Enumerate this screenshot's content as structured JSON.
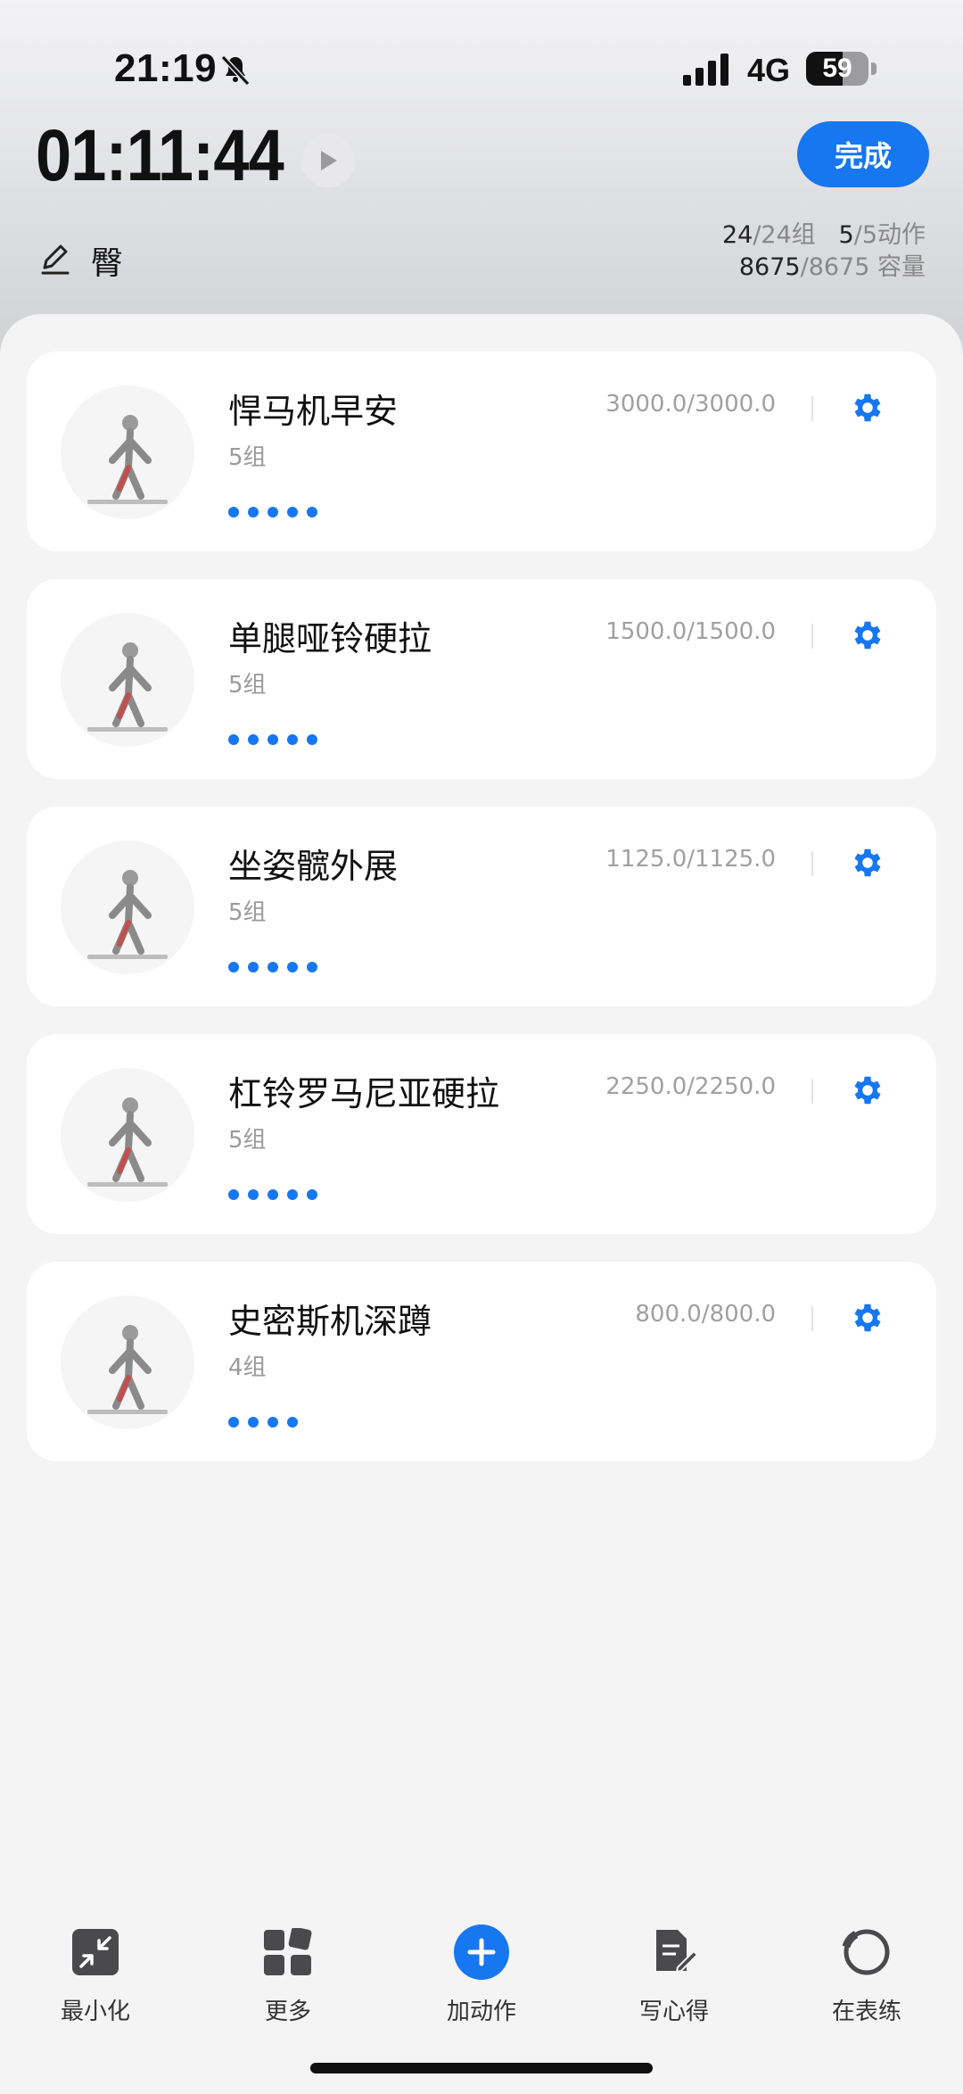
{
  "status_bar": {
    "time": "21:19",
    "network": "4G",
    "battery": "59",
    "battery_level_percent": 59,
    "icons": [
      "bell-muted-icon",
      "signal-icon",
      "battery-icon"
    ]
  },
  "header": {
    "timer": "01:11:44",
    "done_label": "完成",
    "muscle": "臀",
    "sets_done": "24",
    "sets_total": "/24组",
    "actions_done": "5",
    "actions_total": "/5动作",
    "volume_done": "8675",
    "volume_total": "/8675",
    "volume_unit": "容量"
  },
  "exercises": [
    {
      "name": "悍马机早安",
      "sets": "5组",
      "volume": "3000.0/3000.0",
      "dot_count": 5,
      "icon": "machine-good-morning-icon"
    },
    {
      "name": "单腿哑铃硬拉",
      "sets": "5组",
      "volume": "1500.0/1500.0",
      "dot_count": 5,
      "icon": "single-leg-deadlift-icon"
    },
    {
      "name": "坐姿髋外展",
      "sets": "5组",
      "volume": "1125.0/1125.0",
      "dot_count": 5,
      "icon": "seated-hip-abduction-icon"
    },
    {
      "name": "杠铃罗马尼亚硬拉",
      "sets": "5组",
      "volume": "2250.0/2250.0",
      "dot_count": 5,
      "icon": "romanian-deadlift-icon"
    },
    {
      "name": "史密斯机深蹲",
      "sets": "4组",
      "volume": "800.0/800.0",
      "dot_count": 4,
      "icon": "smith-squat-icon"
    }
  ],
  "bottom_nav": [
    {
      "label": "最小化",
      "icon": "minimize-icon"
    },
    {
      "label": "更多",
      "icon": "grid-icon"
    },
    {
      "label": "加动作",
      "icon": "add-circle-icon"
    },
    {
      "label": "写心得",
      "icon": "note-edit-icon"
    },
    {
      "label": "在表练",
      "icon": "watch-icon"
    }
  ],
  "colors": {
    "accent": "#1677f0",
    "card_bg": "#ffffff",
    "page_bg": "#f4f4f5"
  }
}
